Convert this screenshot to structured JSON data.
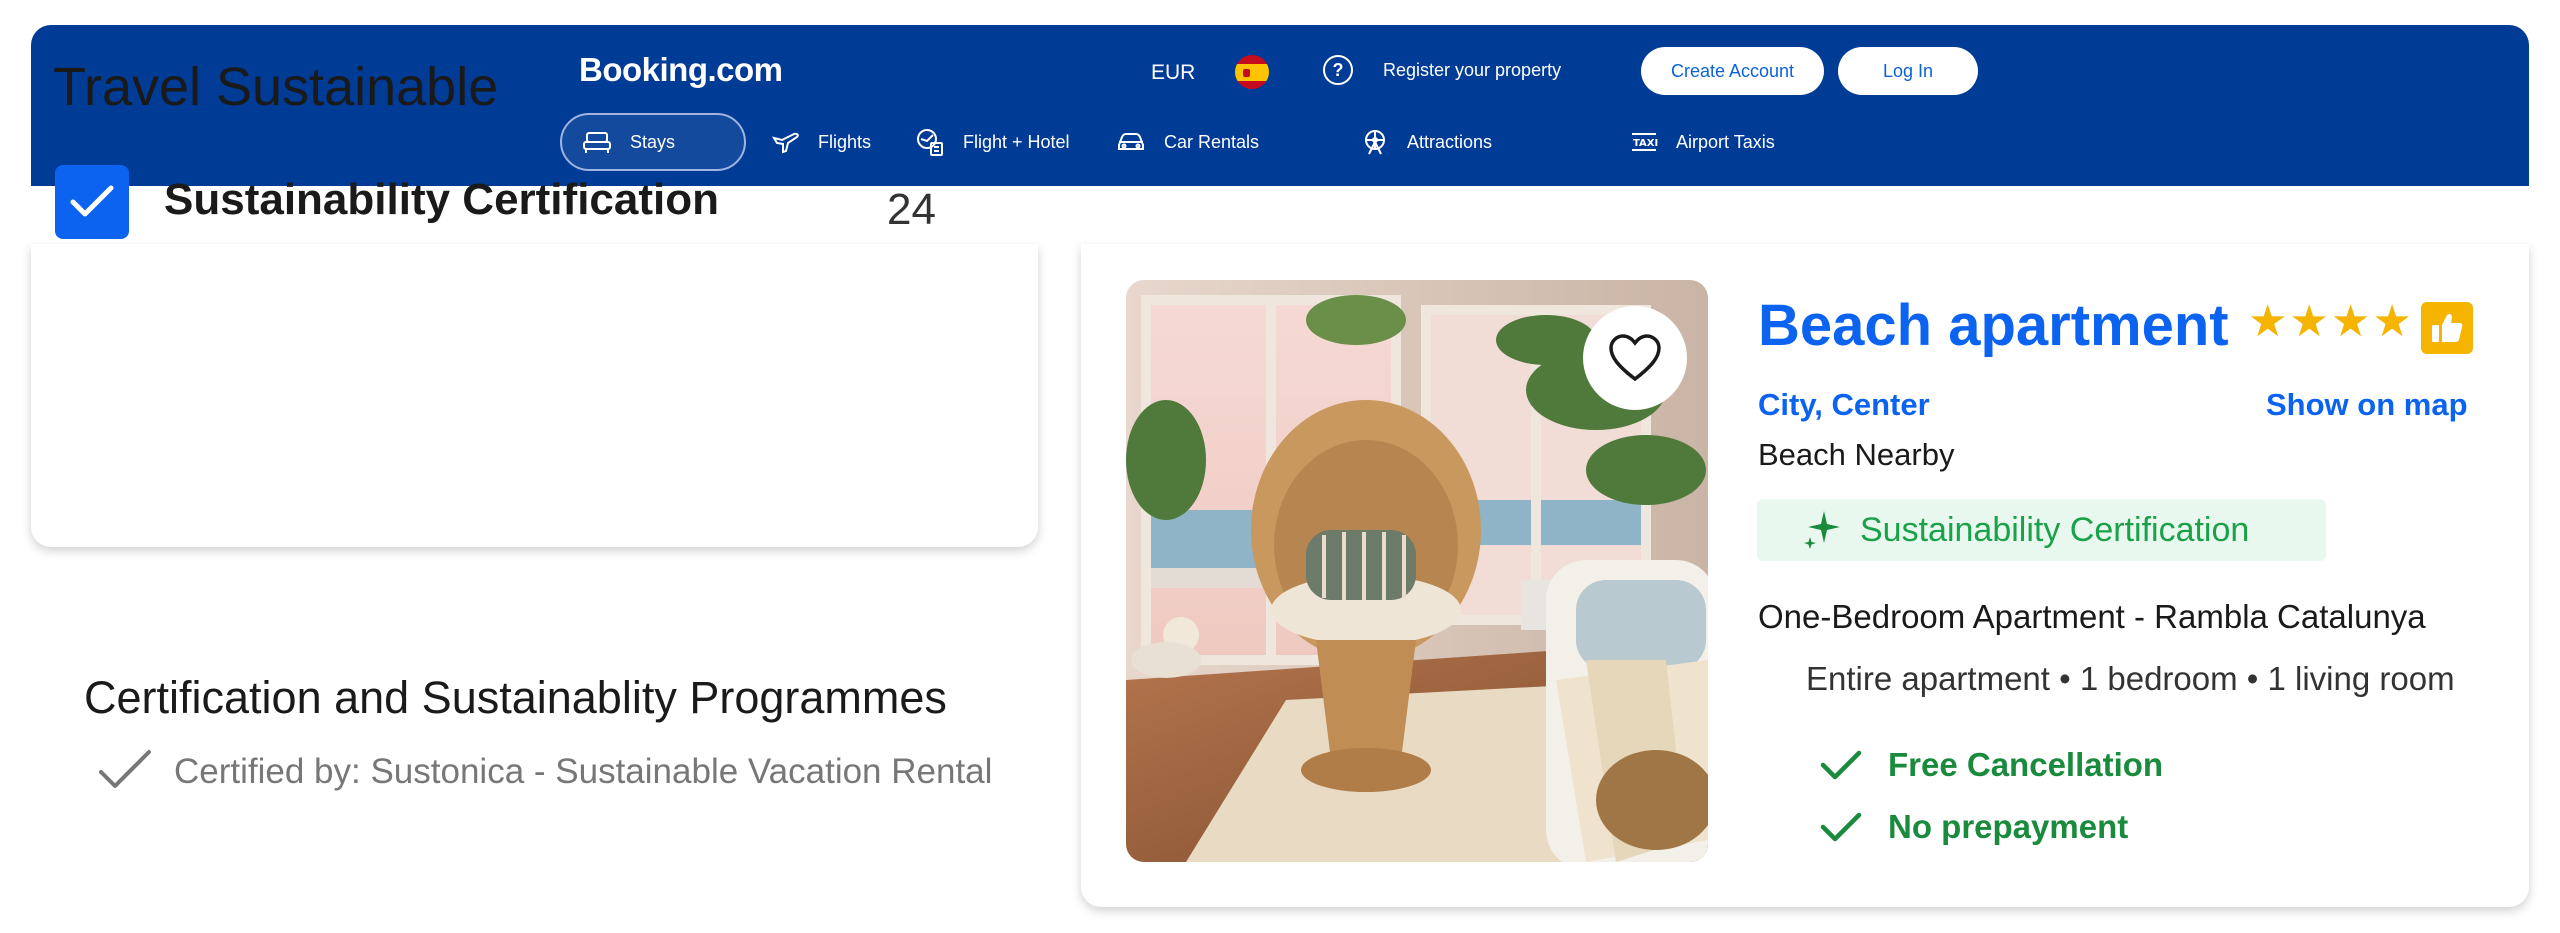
{
  "header": {
    "logo": "Booking.com",
    "currency": "EUR",
    "register_label": "Register your property",
    "create_account_label": "Create Account",
    "login_label": "Log In",
    "nav": [
      {
        "label": "Stays",
        "icon": "bed-icon",
        "active": true
      },
      {
        "label": "Flights",
        "icon": "plane-icon"
      },
      {
        "label": "Flight + Hotel",
        "icon": "flight-hotel-icon"
      },
      {
        "label": "Car Rentals",
        "icon": "car-icon"
      },
      {
        "label": "Attractions",
        "icon": "attractions-icon"
      },
      {
        "label": "Airport Taxis",
        "icon": "taxi-icon"
      }
    ]
  },
  "filter": {
    "title": "Travel Sustainable",
    "option_label": "Sustainability Certification",
    "option_count": "24",
    "checked": true
  },
  "programmes": {
    "title": "Certification and Sustainablity Programmes",
    "certified_by": "Certified by: Sustonica - Sustainable Vacation Rental"
  },
  "listing": {
    "name": "Beach apartment",
    "stars": 4,
    "location": "City, Center",
    "show_on_map": "Show on map",
    "nearby": "Beach Nearby",
    "badge": "Sustainability Certification",
    "room_name": "One-Bedroom Apartment - Rambla Catalunya",
    "room_desc": "Entire apartment • 1 bedroom • 1 living room",
    "features": [
      "Free Cancellation",
      "No prepayment"
    ]
  },
  "colors": {
    "brand": "#003b95",
    "accent_blue": "#0b63f0",
    "star": "#f5b400",
    "green": "#1a8b3d"
  }
}
